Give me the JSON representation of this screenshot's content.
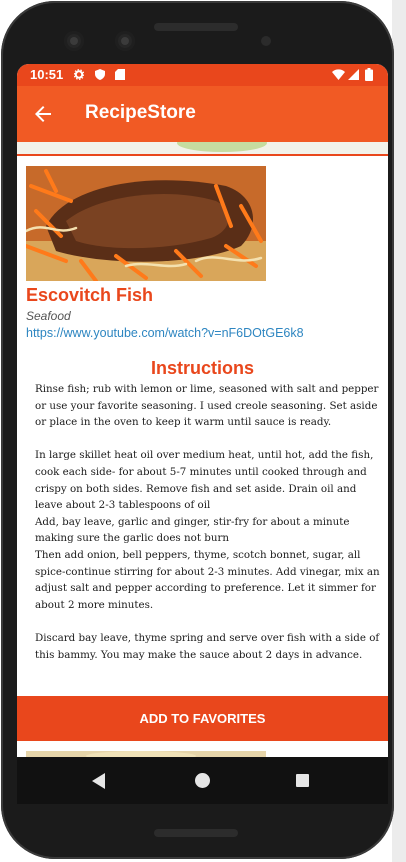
{
  "status_bar": {
    "time": "10:51",
    "icons": [
      "gear-icon",
      "shield-icon",
      "sd-card-icon",
      "wifi-icon",
      "signal-icon",
      "battery-icon"
    ]
  },
  "app_bar": {
    "title": "RecipeStore",
    "back_icon": "arrow-left-icon"
  },
  "meal": {
    "name": "Escovitch Fish",
    "category": "Seafood",
    "youtube_url": "https://www.youtube.com/watch?v=nF6DOtGE6k8"
  },
  "instructions": {
    "heading": "Instructions",
    "text": "Rinse fish; rub with lemon or lime, seasoned with salt and pepper or use your favorite seasoning. I used creole seasoning. Set aside or place in the oven to keep it warm until sauce is ready.\n\nIn large skillet heat oil over medium heat, until hot, add the fish, cook each side- for about 5-7 minutes until cooked through and crispy on both sides. Remove fish and set aside. Drain oil and leave about 2-3 tablespoons of oil\nAdd, bay leave, garlic and ginger, stir-fry for about a minute making sure the garlic does not burn\nThen add onion, bell peppers, thyme, scotch bonnet, sugar, all spice-continue stirring for about 2-3 minutes. Add vinegar, mix an adjust salt and pepper according to preference. Let it simmer for about 2 more minutes.\n\nDiscard bay leave, thyme spring and serve over fish with a side of this bammy. You may make the sauce about 2 days in advance."
  },
  "actions": {
    "add_to_favorites": "ADD TO FAVORITES"
  },
  "colors": {
    "app_bar": "#f15a24",
    "status_bar": "#e9471c",
    "accent": "#e9471c",
    "link": "#2e86c1"
  },
  "navigation_bar": {
    "icons": [
      "nav-back-icon",
      "nav-home-icon",
      "nav-recents-icon"
    ]
  }
}
